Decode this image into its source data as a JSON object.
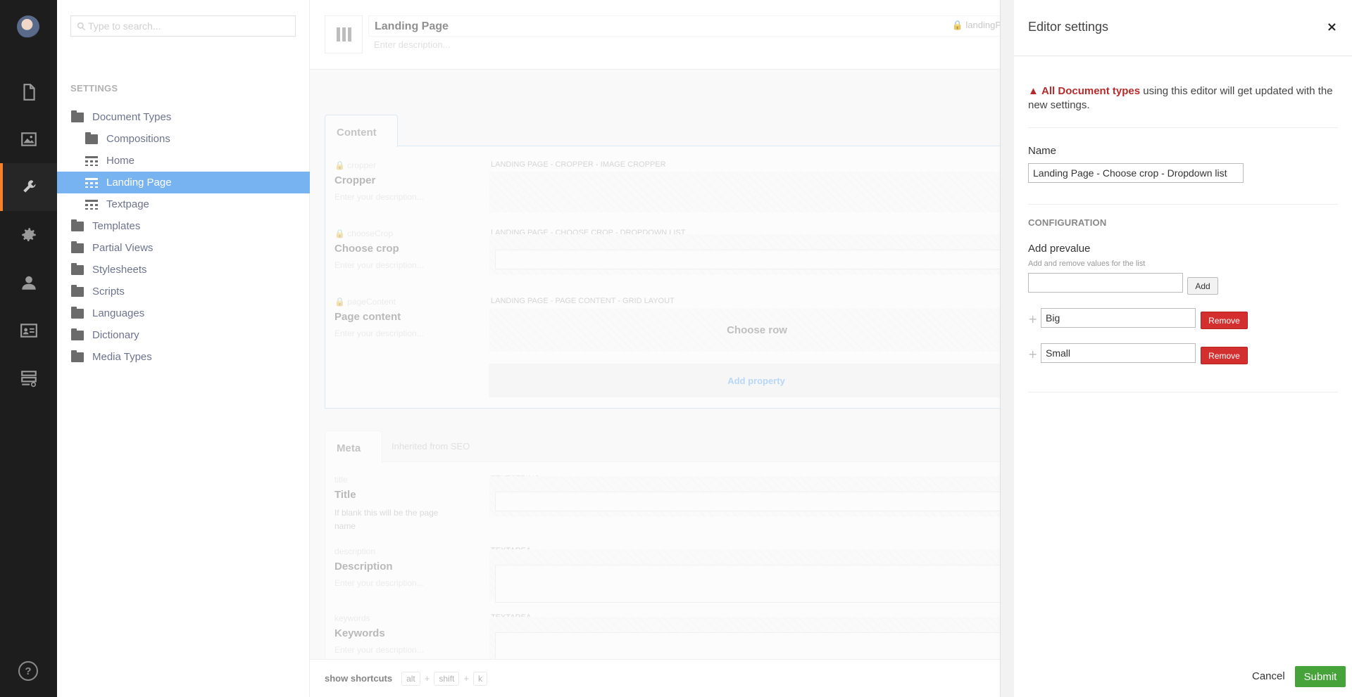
{
  "nav": {
    "items": [
      {
        "icon": "document-icon"
      },
      {
        "icon": "media-icon"
      },
      {
        "icon": "settings-wrench-icon"
      },
      {
        "icon": "gear-icon"
      },
      {
        "icon": "user-icon"
      },
      {
        "icon": "member-card-icon"
      },
      {
        "icon": "forms-icon"
      }
    ],
    "help_label": "?"
  },
  "tree": {
    "search_placeholder": "Type to search...",
    "section_title": "SETTINGS",
    "nodes": [
      {
        "label": "Document Types",
        "icon": "folder-icon",
        "indent": 0
      },
      {
        "label": "Compositions",
        "icon": "folder-icon",
        "indent": 1
      },
      {
        "label": "Home",
        "icon": "doctype-icon",
        "indent": 1
      },
      {
        "label": "Landing Page",
        "icon": "doctype-icon",
        "indent": 1,
        "selected": true
      },
      {
        "label": "Textpage",
        "icon": "doctype-icon",
        "indent": 1
      },
      {
        "label": "Templates",
        "icon": "folder-icon",
        "indent": 0
      },
      {
        "label": "Partial Views",
        "icon": "folder-icon",
        "indent": 0
      },
      {
        "label": "Stylesheets",
        "icon": "folder-icon",
        "indent": 0
      },
      {
        "label": "Scripts",
        "icon": "folder-icon",
        "indent": 0
      },
      {
        "label": "Languages",
        "icon": "folder-icon",
        "indent": 0
      },
      {
        "label": "Dictionary",
        "icon": "folder-icon",
        "indent": 0
      },
      {
        "label": "Media Types",
        "icon": "folder-icon",
        "indent": 0
      }
    ]
  },
  "main": {
    "title": "Landing Page",
    "alias": "landingP",
    "description_placeholder": "Enter description...",
    "content_tab": "Content",
    "content_props": [
      {
        "alias": "cropper",
        "label": "Cropper",
        "desc": "Enter your description...",
        "type": "LANDING PAGE - CROPPER - IMAGE CROPPER"
      },
      {
        "alias": "chooseCrop",
        "label": "Choose crop",
        "desc": "Enter your description...",
        "type": "LANDING PAGE - CHOOSE CROP - DROPDOWN LIST"
      },
      {
        "alias": "pageContent",
        "label": "Page content",
        "desc": "Enter your description...",
        "type": "LANDING PAGE - PAGE CONTENT - GRID LAYOUT"
      }
    ],
    "choose_row": "Choose row",
    "add_property": "Add property",
    "meta_tab": "Meta",
    "inherited": "Inherited from SEO",
    "meta_props": [
      {
        "alias": "title",
        "label": "Title",
        "desc": "If blank this will be the page name",
        "type": "TEXTSTRING"
      },
      {
        "alias": "description",
        "label": "Description",
        "desc": "Enter your description...",
        "type": "TEXTAREA"
      },
      {
        "alias": "keywords",
        "label": "Keywords",
        "desc": "Enter your description...",
        "type": "TEXTAREA"
      }
    ],
    "shortcuts": {
      "label": "show shortcuts",
      "keys": [
        "alt",
        "shift",
        "k"
      ],
      "plus": "+"
    }
  },
  "panel": {
    "title": "Editor settings",
    "close": "×",
    "warning_strong": "All Document types",
    "warning_rest": " using this editor will get updated with the new settings.",
    "warning_icon": "▲",
    "name_label": "Name",
    "name_value": "Landing Page - Choose crop - Dropdown list",
    "config_title": "CONFIGURATION",
    "prevalue_label": "Add prevalue",
    "prevalue_hint": "Add and remove values for the list",
    "add_label": "Add",
    "prevalues": [
      {
        "value": "Big",
        "remove": "Remove"
      },
      {
        "value": "Small",
        "remove": "Remove"
      }
    ],
    "drag_glyph": "+",
    "cancel": "Cancel",
    "submit": "Submit"
  },
  "colors": {
    "accent": "#2f8bea",
    "danger": "#d42f2f",
    "success": "#45a33a",
    "nav_active": "#f5812a"
  }
}
